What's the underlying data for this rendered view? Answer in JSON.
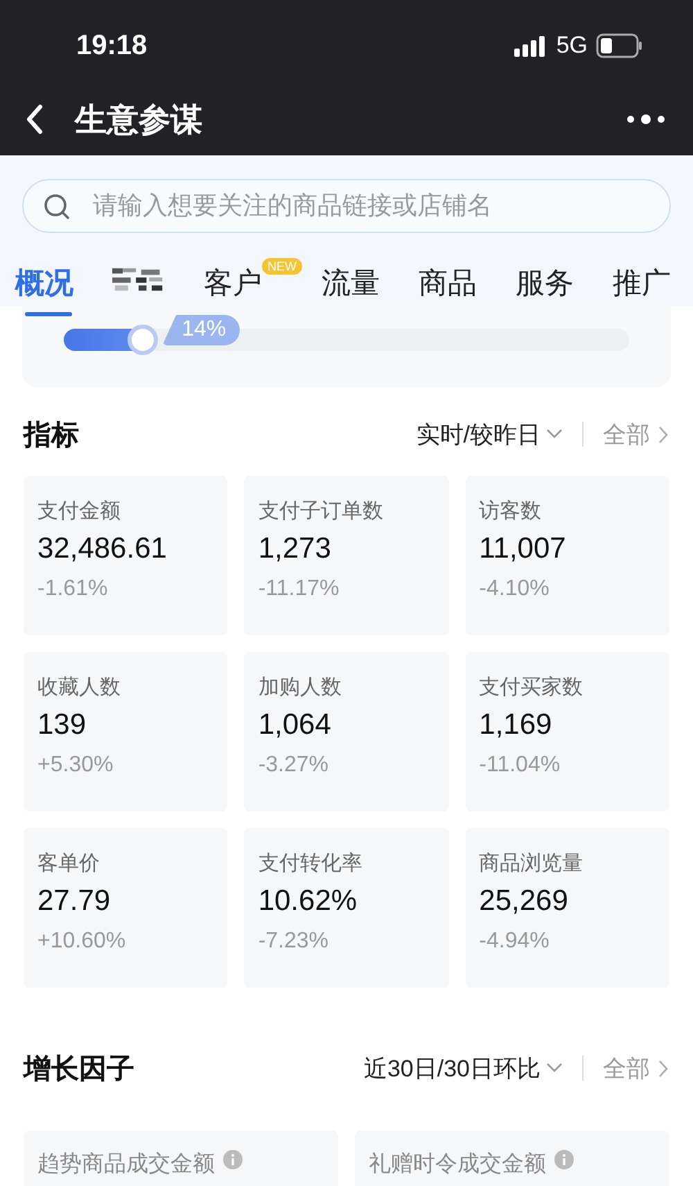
{
  "status_bar": {
    "time": "19:18",
    "network": "5G"
  },
  "nav": {
    "title": "生意参谋"
  },
  "search": {
    "placeholder": "请输入想要关注的商品链接或店铺名"
  },
  "tabs": [
    {
      "kind": "text",
      "label": "概况",
      "selected": true
    },
    {
      "kind": "blurred",
      "selected": false
    },
    {
      "kind": "text",
      "label": "客户",
      "badge": "NEW",
      "selected": false
    },
    {
      "kind": "text",
      "label": "流量",
      "selected": false
    },
    {
      "kind": "text",
      "label": "商品",
      "selected": false
    },
    {
      "kind": "text",
      "label": "服务",
      "selected": false
    },
    {
      "kind": "text",
      "label": "推广",
      "selected": false
    }
  ],
  "progress": {
    "level": 0.14,
    "reading": "14%"
  },
  "indicators": {
    "title": "指标",
    "period": "实时/较昨日",
    "all_link": "全部",
    "cards": [
      {
        "label": "支付金额",
        "value": "32,486.61",
        "change": "-1.61%"
      },
      {
        "label": "支付子订单数",
        "value": "1,273",
        "change": "-11.17%"
      },
      {
        "label": "访客数",
        "value": "11,007",
        "change": "-4.10%"
      },
      {
        "label": "收藏人数",
        "value": "139",
        "change": "+5.30%"
      },
      {
        "label": "加购人数",
        "value": "1,064",
        "change": "-3.27%"
      },
      {
        "label": "支付买家数",
        "value": "1,169",
        "change": "-11.04%"
      },
      {
        "label": "客单价",
        "value": "27.79",
        "change": "+10.60%"
      },
      {
        "label": "支付转化率",
        "value": "10.62%",
        "change": "-7.23%"
      },
      {
        "label": "商品浏览量",
        "value": "25,269",
        "change": "-4.94%"
      }
    ]
  },
  "growth": {
    "title": "增长因子",
    "period": "近30日/30日环比",
    "all_link": "全部",
    "cards": [
      {
        "label": "趋势商品成交金额"
      },
      {
        "label": "礼赠时令成交金额"
      }
    ]
  }
}
